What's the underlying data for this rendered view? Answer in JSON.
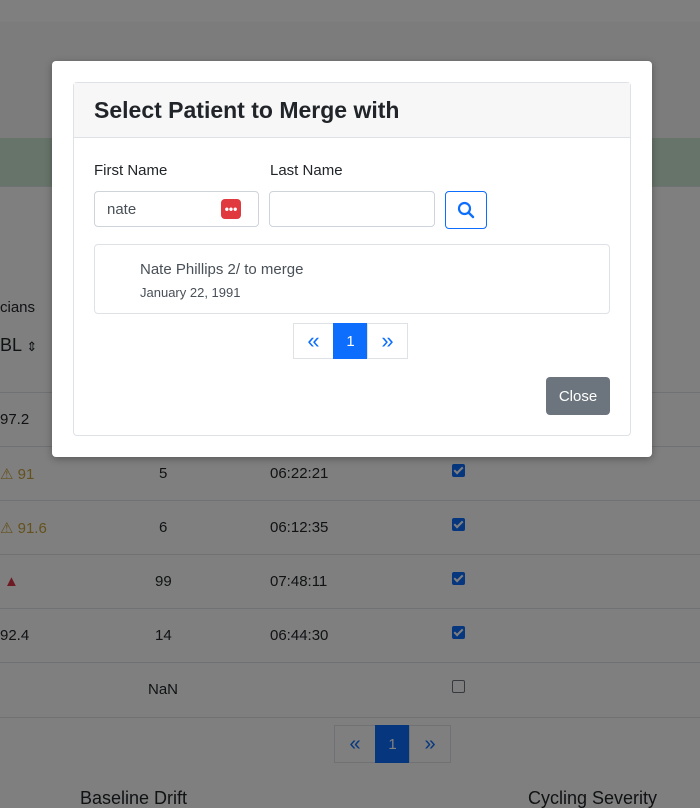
{
  "modal": {
    "title": "Select Patient to Merge with",
    "first_name_label": "First Name",
    "first_name_value": "nate",
    "last_name_label": "Last Name",
    "last_name_value": "",
    "search_icon": "search-icon",
    "results": [
      {
        "name": "Nate Phillips 2/ to merge",
        "dob": "January 22, 1991"
      }
    ],
    "pagination": {
      "prev": "«",
      "current": "1",
      "next": "»"
    },
    "close_label": "Close"
  },
  "background": {
    "column_header_partial": "cians",
    "sort_label_partial": "BL",
    "rows": [
      {
        "value": "97.2",
        "count": "",
        "time": "",
        "checked": false,
        "icon": ""
      },
      {
        "value": "91",
        "count": "5",
        "time": "06:22:21",
        "checked": true,
        "icon": "warning-icon"
      },
      {
        "value": "91.6",
        "count": "6",
        "time": "06:12:35",
        "checked": true,
        "icon": "warning-icon"
      },
      {
        "value": "",
        "count": "99",
        "time": "07:48:11",
        "checked": true,
        "icon": "alert-icon"
      },
      {
        "value": "92.4",
        "count": "14",
        "time": "06:44:30",
        "checked": true,
        "icon": ""
      },
      {
        "value": "",
        "count": "NaN",
        "time": "",
        "checked": false,
        "icon": ""
      }
    ],
    "pagination": {
      "prev": "«",
      "current": "1",
      "next": "»"
    },
    "footer_labels": [
      "Baseline Drift",
      "Cycling Severity"
    ]
  },
  "colors": {
    "primary": "#0d6efd",
    "secondary": "#6c757d",
    "danger": "#e0393e",
    "warning": "#c8a23a"
  }
}
